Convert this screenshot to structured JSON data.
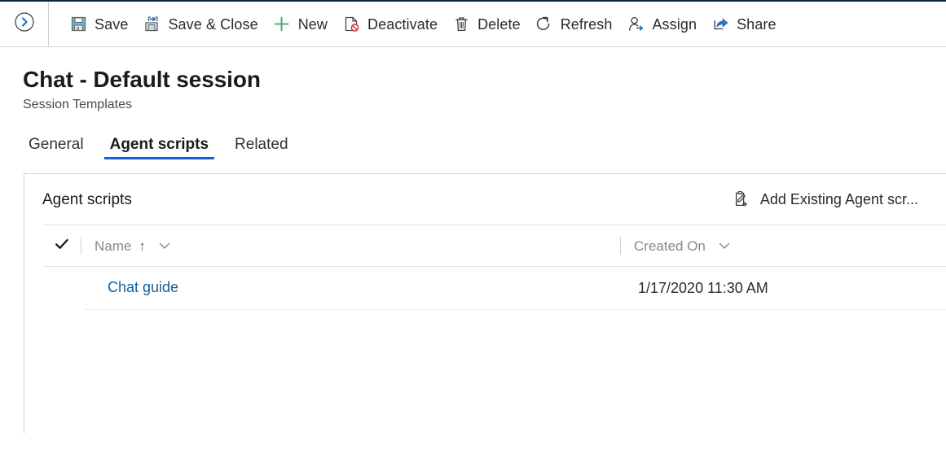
{
  "command_bar": {
    "expand_icon": "chevron-right-circle-icon",
    "buttons": [
      {
        "label": "Save",
        "icon": "save-floppy-icon"
      },
      {
        "label": "Save & Close",
        "icon": "save-and-close-icon"
      },
      {
        "label": "New",
        "icon": "plus-icon"
      },
      {
        "label": "Deactivate",
        "icon": "deactivate-page-block-icon"
      },
      {
        "label": "Delete",
        "icon": "trash-icon"
      },
      {
        "label": "Refresh",
        "icon": "refresh-icon"
      },
      {
        "label": "Assign",
        "icon": "assign-person-arrow-icon"
      },
      {
        "label": "Share",
        "icon": "share-arrow-icon"
      }
    ]
  },
  "header": {
    "title": "Chat - Default session",
    "subtitle": "Session Templates"
  },
  "tabs": [
    {
      "label": "General",
      "active": false
    },
    {
      "label": "Agent scripts",
      "active": true
    },
    {
      "label": "Related",
      "active": false
    }
  ],
  "card": {
    "title": "Agent scripts",
    "action": {
      "label": "Add Existing Agent scr...",
      "icon": "add-existing-clipboard-icon"
    },
    "grid": {
      "select_all_icon": "checkmark-icon",
      "columns": [
        {
          "label": "Name",
          "sort": "↑",
          "has_menu": true
        },
        {
          "label": "Created On",
          "sort": "",
          "has_menu": true
        }
      ],
      "rows": [
        {
          "name": "Chat guide",
          "created_on": "1/17/2020 11:30 AM"
        }
      ]
    }
  },
  "colors": {
    "accent": "#0f62d6",
    "link": "#14609c",
    "icon_blue": "#1a74c4",
    "icon_green": "#3aa76d",
    "icon_red": "#d13438",
    "top_bar": "#0b2545"
  }
}
